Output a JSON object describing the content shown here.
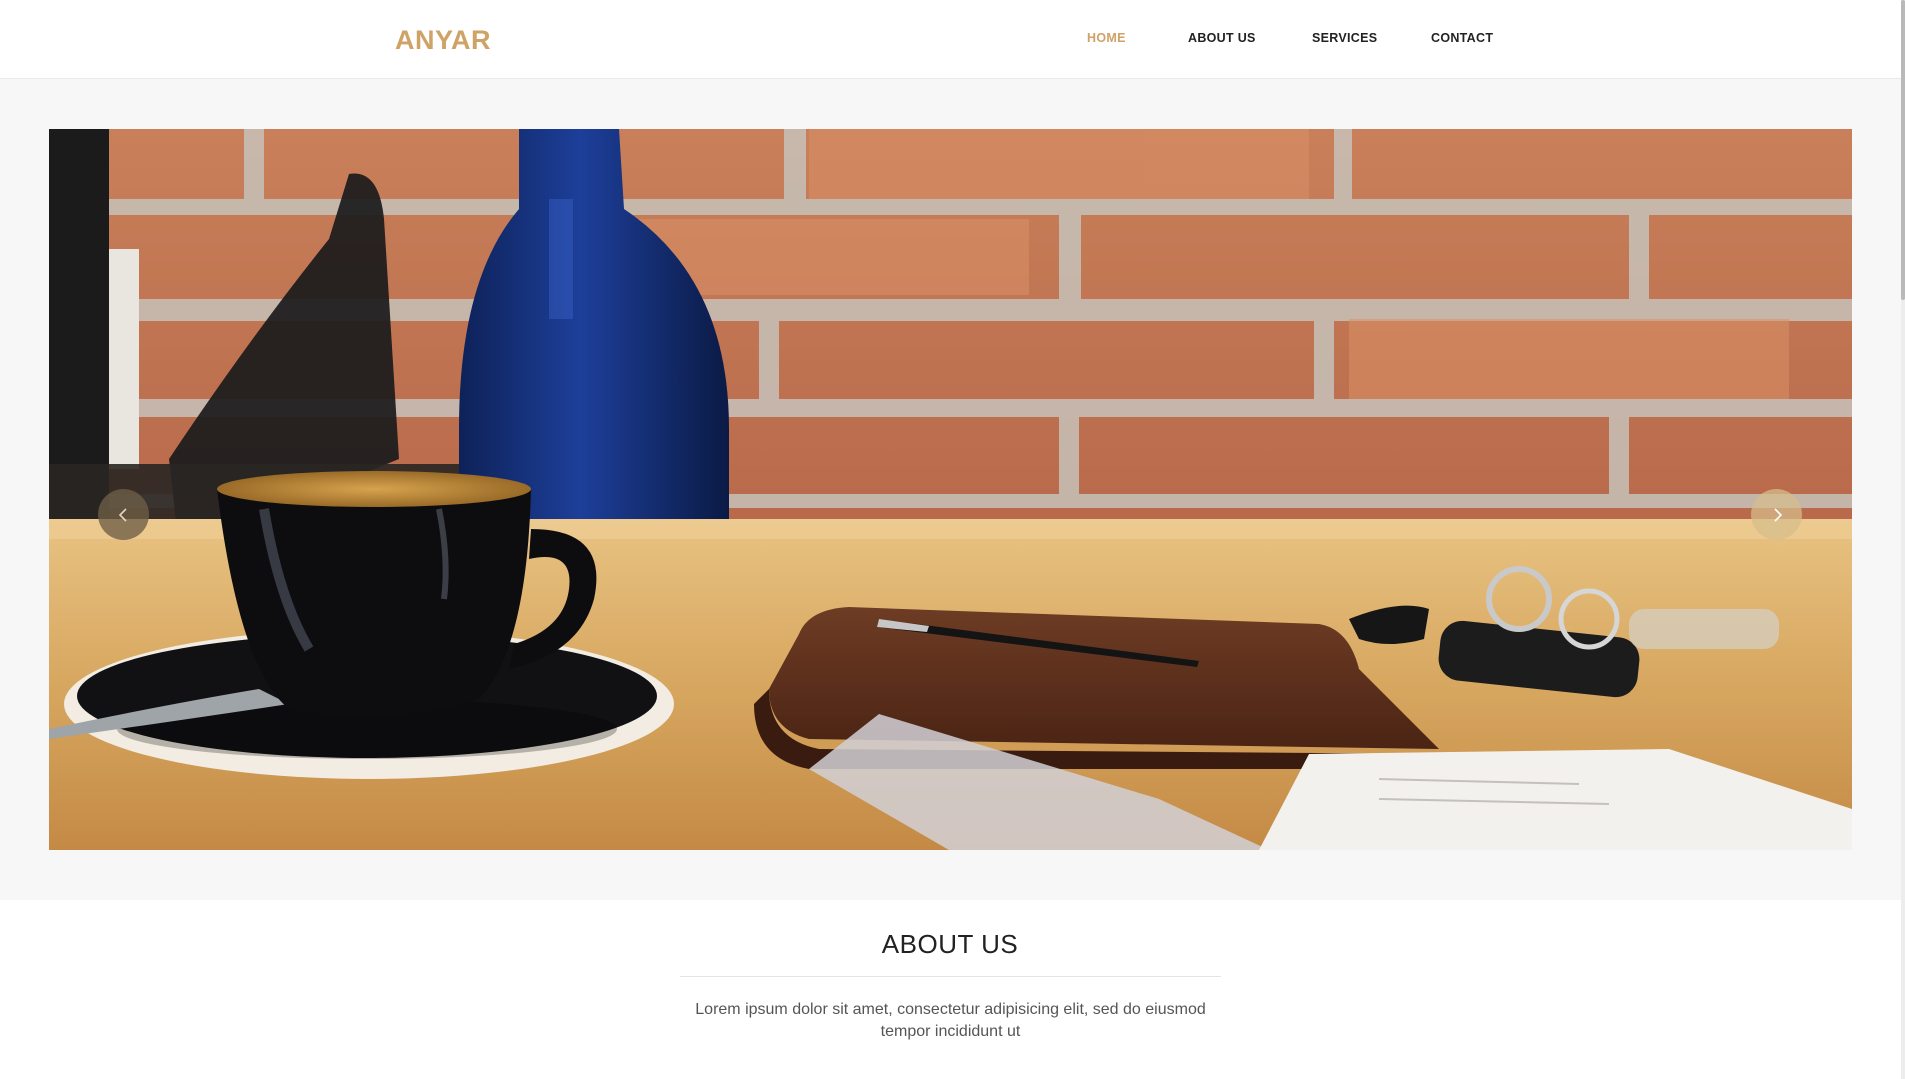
{
  "header": {
    "logo": "ANYAR",
    "nav": [
      {
        "label": "HOME",
        "active": true
      },
      {
        "label": "ABOUT US",
        "active": false
      },
      {
        "label": "SERVICES",
        "active": false
      },
      {
        "label": "CONTACT",
        "active": false
      }
    ]
  },
  "slider": {
    "prev_icon": "chevron-left-icon",
    "next_icon": "chevron-right-icon"
  },
  "about": {
    "title": "ABOUT US",
    "text": "Lorem ipsum dolor sit amet, consectetur adipisicing elit, sed do eiusmod tempor incididunt ut"
  },
  "colors": {
    "accent": "#cfa265",
    "nav_text": "#222222",
    "section_bg": "#f7f7f7"
  }
}
